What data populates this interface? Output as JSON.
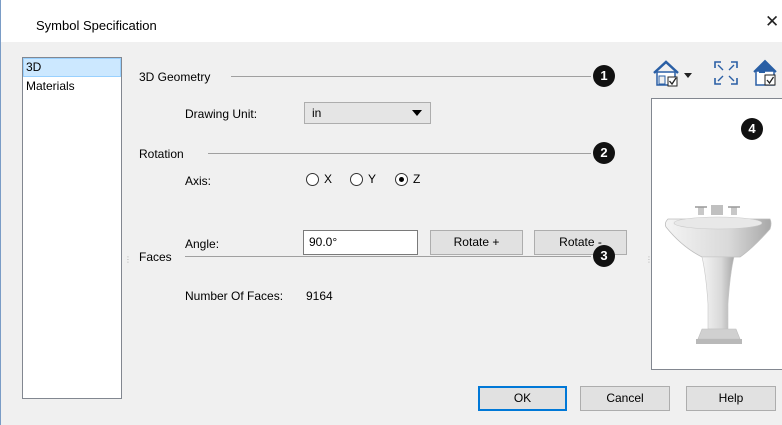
{
  "window": {
    "title": "Symbol Specification",
    "close_glyph": "✕"
  },
  "sidebar": {
    "items": [
      {
        "label": "3D"
      },
      {
        "label": "Materials"
      }
    ]
  },
  "geometry": {
    "heading": "3D Geometry",
    "badge": "1",
    "drawing_unit_label": "Drawing Unit:",
    "drawing_unit_value": "in"
  },
  "rotation": {
    "heading": "Rotation",
    "badge": "2",
    "axis_label": "Axis:",
    "axis_options": [
      "X",
      "Y",
      "Z"
    ],
    "axis_selected": "Z",
    "angle_label": "Angle:",
    "angle_value": "90.0°",
    "rotate_plus": "Rotate +",
    "rotate_minus": "Rotate -"
  },
  "faces": {
    "heading": "Faces",
    "badge": "3",
    "count_label": "Number Of Faces:",
    "count_value": "9164"
  },
  "preview": {
    "badge": "4",
    "toolbar_icons": [
      "house-view-dropdown-icon",
      "fit-view-icon",
      "preview-settings-icon"
    ]
  },
  "footer": {
    "ok": "OK",
    "cancel": "Cancel",
    "help": "Help"
  },
  "colors": {
    "badge": "#111111",
    "selection": "#cce8ff",
    "default_button_border": "#0078d7"
  }
}
